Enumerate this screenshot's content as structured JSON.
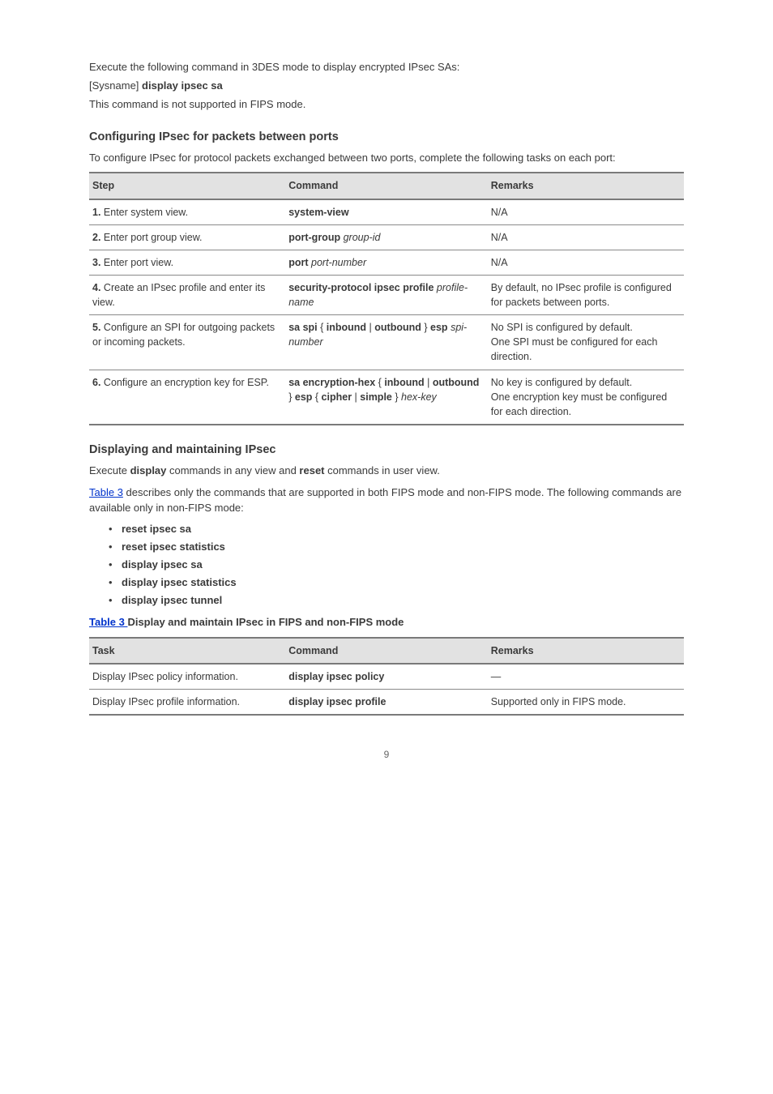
{
  "intro": {
    "p1": "Execute the following command in 3DES mode to display encrypted IPsec SAs:",
    "p2_prefix": "[Sysname]",
    "p2_cmd": "display ipsec sa",
    "p3": "This command is not supported in FIPS mode."
  },
  "section1": {
    "title": "Configuring IPsec for packets between ports",
    "body": "To configure IPsec for protocol packets exchanged between two ports, complete the following tasks on each port:"
  },
  "table1": {
    "headers": [
      "Step",
      "Command",
      "Remarks"
    ],
    "rows": [
      {
        "step_num": "1.",
        "step_text": "Enter system view.",
        "command": "system-view",
        "remarks": "N/A"
      },
      {
        "step_num": "2.",
        "step_text": "Enter port group view.",
        "command_prefix": "port-group",
        "command_arg": "group-id",
        "remarks": "N/A"
      },
      {
        "step_num": "3.",
        "step_text": "Enter port view.",
        "command_prefix": "port",
        "command_arg": "port-number",
        "remarks": "N/A"
      },
      {
        "step_num": "4.",
        "step_text": "Create an IPsec profile and enter its view.",
        "command_prefix": "security-protocol ipsec profile",
        "command_arg": "profile-name",
        "remarks": "By default, no IPsec profile is configured for packets between ports."
      },
      {
        "step_num": "5.",
        "step_text_full": "Configure an SPI for outgoing packets or incoming packets.",
        "command_prefix_a": "sa spi",
        "command_mid_a": " { ",
        "command_opt1_a": "inbound",
        "command_pipe_a": " | ",
        "command_opt2_a": "outbound",
        "command_mid2_a": " } ",
        "command_opt3_a": "esp",
        "command_arg_a": "spi-number",
        "remarks_a_l1": "No SPI is configured by default.",
        "remarks_a_l2": "One SPI must be configured for each direction."
      },
      {
        "step_num_b": "6.",
        "step_text_b": "Configure an encryption key for ESP.",
        "command_b_1": "sa encryption-hex ",
        "command_b_brace": "{ ",
        "command_b_opt1": "inbound",
        "command_b_pipe": " | ",
        "command_b_opt2": "outbound",
        "command_b_mid": " } ",
        "command_b_esp": "esp",
        "command_b_sp": " { ",
        "command_b_cipher": "cipher",
        "command_b_sp2": " | ",
        "command_b_simple": "simple",
        "command_b_end": " } ",
        "command_b_arg": "hex-key",
        "remarks_b_l1": "No key is configured by default.",
        "remarks_b_l2": "One encryption key must be configured for each direction."
      }
    ]
  },
  "section2": {
    "title": "Displaying and maintaining IPsec",
    "table_label": "Table 3",
    "lead": "Execute ",
    "cmd": "display",
    "tail": " commands in any view and ",
    "cmd2": "reset",
    "tail2": " commands in user view.",
    "list_lead": " describes only the commands that are supported in both FIPS mode and non-FIPS mode. The following commands are available only in non-FIPS mode:",
    "bullets": [
      "reset ipsec sa",
      "reset ipsec statistics",
      "display ipsec sa",
      "display ipsec statistics",
      "display ipsec tunnel"
    ],
    "ref_text": "Display and maintain IPsec in FIPS and non-FIPS mode",
    "table_link_sentence_prefix": "Table 3 ",
    "table_link_sentence": "Display and maintain IPsec in FIPS and non-FIPS mode"
  },
  "table2": {
    "headers": [
      "Task",
      "Command",
      "Remarks"
    ],
    "rows": [
      {
        "task": "Display IPsec policy information.",
        "command_prefix": "display ipsec policy",
        "remarks": "—"
      },
      {
        "task": "Display IPsec profile information.",
        "command_prefix": "display ipsec profile",
        "remarks": "Supported only in FIPS mode."
      }
    ]
  },
  "page_number": "9"
}
